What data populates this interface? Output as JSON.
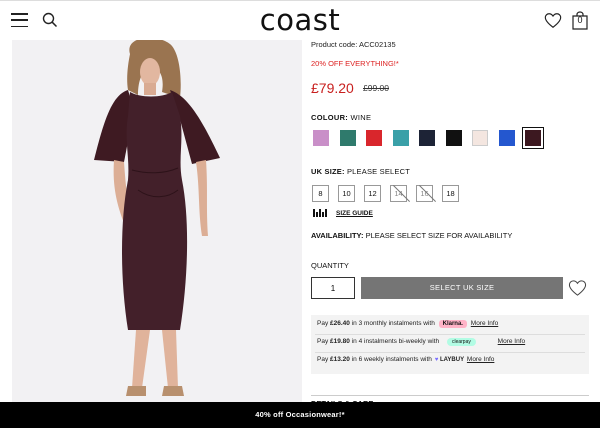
{
  "header": {
    "logo": "coast",
    "bag_count": "0"
  },
  "product": {
    "code": "Product code: ACC02135",
    "promo": "20% OFF EVERYTHING!*",
    "price": "£79.20",
    "was_price": "£99.00",
    "colour_label": "COLOUR:",
    "colour_value": "WINE",
    "swatches": [
      {
        "name": "lilac",
        "color": "#c98fc8"
      },
      {
        "name": "teal",
        "color": "#2f7a6c"
      },
      {
        "name": "red",
        "color": "#d9262c"
      },
      {
        "name": "aqua",
        "color": "#3aa0a8"
      },
      {
        "name": "navy",
        "color": "#1d2336"
      },
      {
        "name": "black",
        "color": "#111111"
      },
      {
        "name": "blush",
        "color": "#f4e6e0"
      },
      {
        "name": "blue",
        "color": "#2457cf"
      },
      {
        "name": "wine",
        "color": "#3c1820",
        "selected": true
      }
    ],
    "size_label": "UK SIZE:",
    "size_value": "PLEASE SELECT",
    "sizes": [
      {
        "label": "8",
        "available": true
      },
      {
        "label": "10",
        "available": true
      },
      {
        "label": "12",
        "available": true
      },
      {
        "label": "14",
        "available": false
      },
      {
        "label": "16",
        "available": false
      },
      {
        "label": "18",
        "available": true
      }
    ],
    "size_guide": "SIZE GUIDE",
    "availability_label": "AVAILABILITY:",
    "availability_value": "PLEASE SELECT SIZE FOR AVAILABILITY",
    "quantity_label": "QUANTITY",
    "quantity_value": "1",
    "select_button": "SELECT UK SIZE"
  },
  "payments": {
    "klarna": {
      "pre": "Pay ",
      "amount": "£26.40",
      "post": " in 3 monthly instalments with",
      "badge": "Klarna.",
      "more": "More Info"
    },
    "clearpay": {
      "pre": "Pay ",
      "amount": "£19.80",
      "post": " in 4 instalments bi-weekly with",
      "badge": "clearpay",
      "more": "More Info"
    },
    "laybuy": {
      "pre": "Pay ",
      "amount": "£13.20",
      "post": " in 6 weekly instalments with",
      "badge": "LAYBUY",
      "more": "More Info"
    }
  },
  "details_care": "DETAILS & CARE",
  "banner": "40% off Occasionwear!*"
}
